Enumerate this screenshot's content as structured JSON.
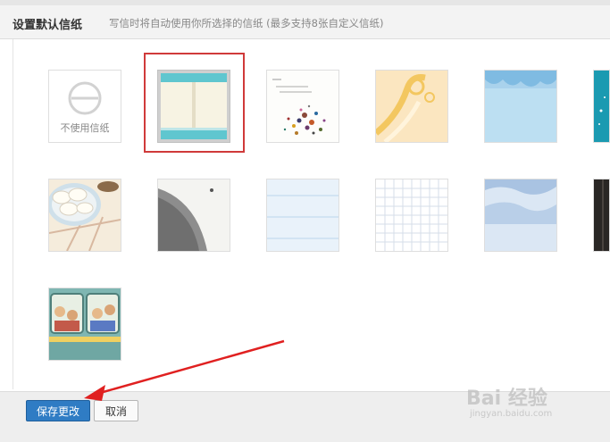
{
  "header": {
    "title": "设置默认信纸",
    "hint": "写信时将自动使用你所选择的信纸 (最多支持8张自定义信纸)"
  },
  "stationery": {
    "no_use_label": "不使用信纸",
    "selected_item": "stationery-teal-book"
  },
  "footer": {
    "save_label": "保存更改",
    "cancel_label": "取消"
  },
  "watermark": {
    "text": "Bai 经验",
    "url": "jingyan.baidu.com"
  },
  "colors": {
    "selection_border": "#d03a3a",
    "save_button": "#2f7cc4",
    "arrow": "#e02020"
  }
}
